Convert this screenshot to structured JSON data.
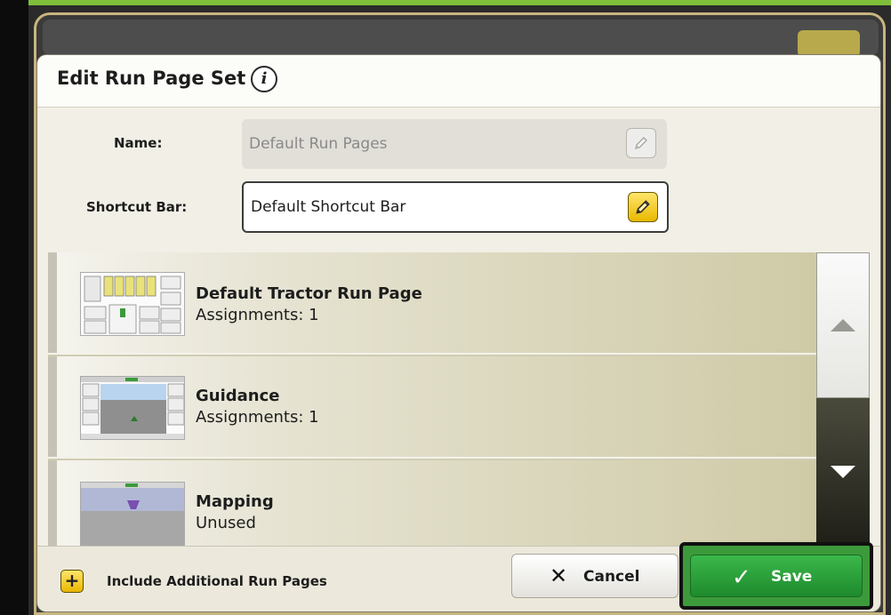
{
  "dialog": {
    "title": "Edit Run Page Set",
    "info_icon": "info-icon"
  },
  "form": {
    "name_label": "Name:",
    "name_value": "Default Run Pages",
    "shortcut_label": "Shortcut Bar:",
    "shortcut_value": "Default Shortcut Bar"
  },
  "run_pages": [
    {
      "title": "Default Tractor Run Page",
      "status": "Assignments: 1"
    },
    {
      "title": "Guidance",
      "status": "Assignments: 1"
    },
    {
      "title": "Mapping",
      "status": "Unused"
    }
  ],
  "footer": {
    "include_label": "Include Additional Run Pages",
    "cancel_label": "Cancel",
    "save_label": "Save"
  },
  "colors": {
    "accent_yellow": "#f5cf1a",
    "save_green": "#2e9b3c",
    "frame_green": "#7fbf3a"
  }
}
